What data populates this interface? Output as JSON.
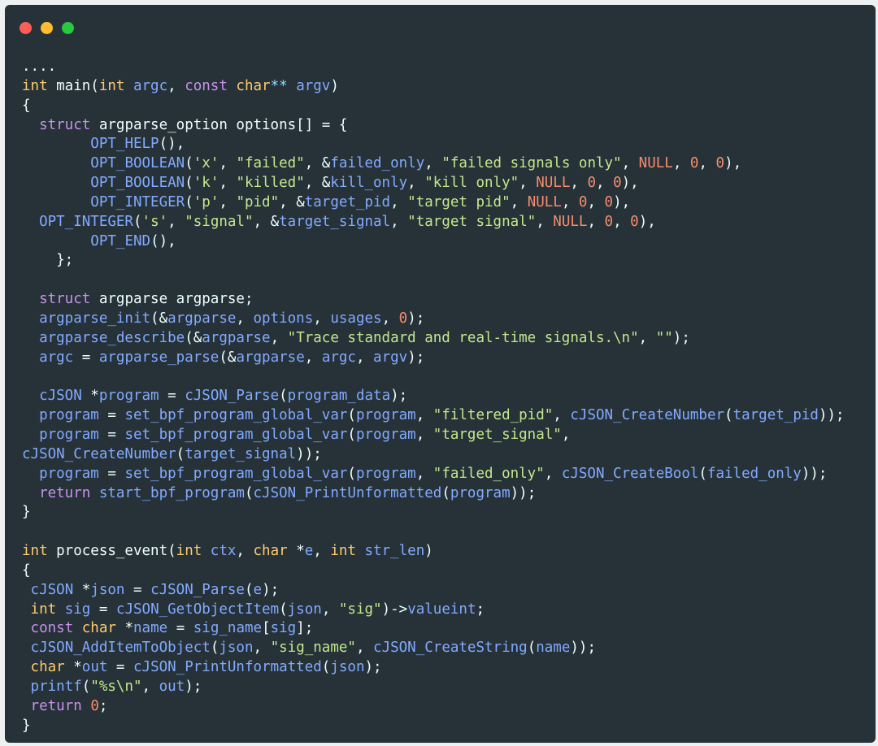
{
  "window": {
    "controls": [
      {
        "name": "close",
        "color": "#ff5f56"
      },
      {
        "name": "minimize",
        "color": "#ffbd2e"
      },
      {
        "name": "zoom",
        "color": "#27c93f"
      }
    ]
  },
  "code": {
    "language": "c",
    "lines": [
      [
        [
          "plain",
          "...."
        ]
      ],
      [
        [
          "type",
          "int"
        ],
        [
          "plain",
          " main("
        ],
        [
          "type",
          "int"
        ],
        [
          "var",
          " argc"
        ],
        [
          "plain",
          ", "
        ],
        [
          "kw",
          "const"
        ],
        [
          "type",
          " char"
        ],
        [
          "op",
          "**"
        ],
        [
          "var",
          " argv"
        ],
        [
          "plain",
          ")"
        ]
      ],
      [
        [
          "plain",
          "{"
        ]
      ],
      [
        [
          "plain",
          "  "
        ],
        [
          "kw",
          "struct"
        ],
        [
          "plain",
          " argparse_option options[] = {"
        ]
      ],
      [
        [
          "plain",
          "        "
        ],
        [
          "fn",
          "OPT_HELP"
        ],
        [
          "plain",
          "(),"
        ]
      ],
      [
        [
          "plain",
          "        "
        ],
        [
          "fn",
          "OPT_BOOLEAN"
        ],
        [
          "plain",
          "("
        ],
        [
          "str",
          "'x'"
        ],
        [
          "plain",
          ", "
        ],
        [
          "str",
          "\"failed\""
        ],
        [
          "plain",
          ", &"
        ],
        [
          "var",
          "failed_only"
        ],
        [
          "plain",
          ", "
        ],
        [
          "str",
          "\"failed signals only\""
        ],
        [
          "plain",
          ", "
        ],
        [
          "null",
          "NULL"
        ],
        [
          "plain",
          ", "
        ],
        [
          "num",
          "0"
        ],
        [
          "plain",
          ", "
        ],
        [
          "num",
          "0"
        ],
        [
          "plain",
          "),"
        ]
      ],
      [
        [
          "plain",
          "        "
        ],
        [
          "fn",
          "OPT_BOOLEAN"
        ],
        [
          "plain",
          "("
        ],
        [
          "str",
          "'k'"
        ],
        [
          "plain",
          ", "
        ],
        [
          "str",
          "\"killed\""
        ],
        [
          "plain",
          ", &"
        ],
        [
          "var",
          "kill_only"
        ],
        [
          "plain",
          ", "
        ],
        [
          "str",
          "\"kill only\""
        ],
        [
          "plain",
          ", "
        ],
        [
          "null",
          "NULL"
        ],
        [
          "plain",
          ", "
        ],
        [
          "num",
          "0"
        ],
        [
          "plain",
          ", "
        ],
        [
          "num",
          "0"
        ],
        [
          "plain",
          "),"
        ]
      ],
      [
        [
          "plain",
          "        "
        ],
        [
          "fn",
          "OPT_INTEGER"
        ],
        [
          "plain",
          "("
        ],
        [
          "str",
          "'p'"
        ],
        [
          "plain",
          ", "
        ],
        [
          "str",
          "\"pid\""
        ],
        [
          "plain",
          ", &"
        ],
        [
          "var",
          "target_pid"
        ],
        [
          "plain",
          ", "
        ],
        [
          "str",
          "\"target pid\""
        ],
        [
          "plain",
          ", "
        ],
        [
          "null",
          "NULL"
        ],
        [
          "plain",
          ", "
        ],
        [
          "num",
          "0"
        ],
        [
          "plain",
          ", "
        ],
        [
          "num",
          "0"
        ],
        [
          "plain",
          "),"
        ]
      ],
      [
        [
          "plain",
          "  "
        ],
        [
          "fn",
          "OPT_INTEGER"
        ],
        [
          "plain",
          "("
        ],
        [
          "str",
          "'s'"
        ],
        [
          "plain",
          ", "
        ],
        [
          "str",
          "\"signal\""
        ],
        [
          "plain",
          ", &"
        ],
        [
          "var",
          "target_signal"
        ],
        [
          "plain",
          ", "
        ],
        [
          "str",
          "\"target signal\""
        ],
        [
          "plain",
          ", "
        ],
        [
          "null",
          "NULL"
        ],
        [
          "plain",
          ", "
        ],
        [
          "num",
          "0"
        ],
        [
          "plain",
          ", "
        ],
        [
          "num",
          "0"
        ],
        [
          "plain",
          "),"
        ]
      ],
      [
        [
          "plain",
          "        "
        ],
        [
          "fn",
          "OPT_END"
        ],
        [
          "plain",
          "(),"
        ]
      ],
      [
        [
          "plain",
          "    };"
        ]
      ],
      [
        [
          "plain",
          ""
        ]
      ],
      [
        [
          "plain",
          "  "
        ],
        [
          "kw",
          "struct"
        ],
        [
          "plain",
          " argparse argparse;"
        ]
      ],
      [
        [
          "plain",
          "  "
        ],
        [
          "fn",
          "argparse_init"
        ],
        [
          "plain",
          "(&"
        ],
        [
          "var",
          "argparse"
        ],
        [
          "plain",
          ", "
        ],
        [
          "var",
          "options"
        ],
        [
          "plain",
          ", "
        ],
        [
          "var",
          "usages"
        ],
        [
          "plain",
          ", "
        ],
        [
          "num",
          "0"
        ],
        [
          "plain",
          ");"
        ]
      ],
      [
        [
          "plain",
          "  "
        ],
        [
          "fn",
          "argparse_describe"
        ],
        [
          "plain",
          "(&"
        ],
        [
          "var",
          "argparse"
        ],
        [
          "plain",
          ", "
        ],
        [
          "str",
          "\"Trace standard and real-time signals.\\n\""
        ],
        [
          "plain",
          ", "
        ],
        [
          "str",
          "\"\""
        ],
        [
          "plain",
          ");"
        ]
      ],
      [
        [
          "plain",
          "  "
        ],
        [
          "var",
          "argc"
        ],
        [
          "plain",
          " = "
        ],
        [
          "fn",
          "argparse_parse"
        ],
        [
          "plain",
          "(&"
        ],
        [
          "var",
          "argparse"
        ],
        [
          "plain",
          ", "
        ],
        [
          "var",
          "argc"
        ],
        [
          "plain",
          ", "
        ],
        [
          "var",
          "argv"
        ],
        [
          "plain",
          ");"
        ]
      ],
      [
        [
          "plain",
          ""
        ]
      ],
      [
        [
          "plain",
          "  "
        ],
        [
          "var",
          "cJSON"
        ],
        [
          "plain",
          " *"
        ],
        [
          "var",
          "program"
        ],
        [
          "plain",
          " = "
        ],
        [
          "fn",
          "cJSON_Parse"
        ],
        [
          "plain",
          "("
        ],
        [
          "var",
          "program_data"
        ],
        [
          "plain",
          ");"
        ]
      ],
      [
        [
          "plain",
          "  "
        ],
        [
          "var",
          "program"
        ],
        [
          "plain",
          " = "
        ],
        [
          "fn",
          "set_bpf_program_global_var"
        ],
        [
          "plain",
          "("
        ],
        [
          "var",
          "program"
        ],
        [
          "plain",
          ", "
        ],
        [
          "str",
          "\"filtered_pid\""
        ],
        [
          "plain",
          ", "
        ],
        [
          "fn",
          "cJSON_CreateNumber"
        ],
        [
          "plain",
          "("
        ],
        [
          "var",
          "target_pid"
        ],
        [
          "plain",
          "));"
        ]
      ],
      [
        [
          "plain",
          "  "
        ],
        [
          "var",
          "program"
        ],
        [
          "plain",
          " = "
        ],
        [
          "fn",
          "set_bpf_program_global_var"
        ],
        [
          "plain",
          "("
        ],
        [
          "var",
          "program"
        ],
        [
          "plain",
          ", "
        ],
        [
          "str",
          "\"target_signal\""
        ],
        [
          "plain",
          ","
        ]
      ],
      [
        [
          "fn",
          "cJSON_CreateNumber"
        ],
        [
          "plain",
          "("
        ],
        [
          "var",
          "target_signal"
        ],
        [
          "plain",
          "));"
        ]
      ],
      [
        [
          "plain",
          "  "
        ],
        [
          "var",
          "program"
        ],
        [
          "plain",
          " = "
        ],
        [
          "fn",
          "set_bpf_program_global_var"
        ],
        [
          "plain",
          "("
        ],
        [
          "var",
          "program"
        ],
        [
          "plain",
          ", "
        ],
        [
          "str",
          "\"failed_only\""
        ],
        [
          "plain",
          ", "
        ],
        [
          "fn",
          "cJSON_CreateBool"
        ],
        [
          "plain",
          "("
        ],
        [
          "var",
          "failed_only"
        ],
        [
          "plain",
          "));"
        ]
      ],
      [
        [
          "plain",
          "  "
        ],
        [
          "kw",
          "return"
        ],
        [
          "plain",
          " "
        ],
        [
          "fn",
          "start_bpf_program"
        ],
        [
          "plain",
          "("
        ],
        [
          "fn",
          "cJSON_PrintUnformatted"
        ],
        [
          "plain",
          "("
        ],
        [
          "var",
          "program"
        ],
        [
          "plain",
          "));"
        ]
      ],
      [
        [
          "plain",
          "}"
        ]
      ],
      [
        [
          "plain",
          ""
        ]
      ],
      [
        [
          "type",
          "int"
        ],
        [
          "plain",
          " process_event("
        ],
        [
          "type",
          "int"
        ],
        [
          "var",
          " ctx"
        ],
        [
          "plain",
          ", "
        ],
        [
          "type",
          "char"
        ],
        [
          "plain",
          " *"
        ],
        [
          "var",
          "e"
        ],
        [
          "plain",
          ", "
        ],
        [
          "type",
          "int"
        ],
        [
          "var",
          " str_len"
        ],
        [
          "plain",
          ")"
        ]
      ],
      [
        [
          "plain",
          "{"
        ]
      ],
      [
        [
          "plain",
          " "
        ],
        [
          "var",
          "cJSON"
        ],
        [
          "plain",
          " *"
        ],
        [
          "var",
          "json"
        ],
        [
          "plain",
          " = "
        ],
        [
          "fn",
          "cJSON_Parse"
        ],
        [
          "plain",
          "("
        ],
        [
          "var",
          "e"
        ],
        [
          "plain",
          ");"
        ]
      ],
      [
        [
          "plain",
          " "
        ],
        [
          "type",
          "int"
        ],
        [
          "var",
          " sig"
        ],
        [
          "plain",
          " = "
        ],
        [
          "fn",
          "cJSON_GetObjectItem"
        ],
        [
          "plain",
          "("
        ],
        [
          "var",
          "json"
        ],
        [
          "plain",
          ", "
        ],
        [
          "str",
          "\"sig\""
        ],
        [
          "plain",
          ")->"
        ],
        [
          "var",
          "valueint"
        ],
        [
          "plain",
          ";"
        ]
      ],
      [
        [
          "plain",
          " "
        ],
        [
          "kw",
          "const"
        ],
        [
          "type",
          " char"
        ],
        [
          "plain",
          " *"
        ],
        [
          "var",
          "name"
        ],
        [
          "plain",
          " = "
        ],
        [
          "var",
          "sig_name"
        ],
        [
          "plain",
          "["
        ],
        [
          "var",
          "sig"
        ],
        [
          "plain",
          "];"
        ]
      ],
      [
        [
          "plain",
          " "
        ],
        [
          "fn",
          "cJSON_AddItemToObject"
        ],
        [
          "plain",
          "("
        ],
        [
          "var",
          "json"
        ],
        [
          "plain",
          ", "
        ],
        [
          "str",
          "\"sig_name\""
        ],
        [
          "plain",
          ", "
        ],
        [
          "fn",
          "cJSON_CreateString"
        ],
        [
          "plain",
          "("
        ],
        [
          "var",
          "name"
        ],
        [
          "plain",
          "));"
        ]
      ],
      [
        [
          "plain",
          " "
        ],
        [
          "type",
          "char"
        ],
        [
          "plain",
          " *"
        ],
        [
          "var",
          "out"
        ],
        [
          "plain",
          " = "
        ],
        [
          "fn",
          "cJSON_PrintUnformatted"
        ],
        [
          "plain",
          "("
        ],
        [
          "var",
          "json"
        ],
        [
          "plain",
          ");"
        ]
      ],
      [
        [
          "plain",
          " "
        ],
        [
          "fn",
          "printf"
        ],
        [
          "plain",
          "("
        ],
        [
          "str",
          "\"%s\\n\""
        ],
        [
          "plain",
          ", "
        ],
        [
          "var",
          "out"
        ],
        [
          "plain",
          ");"
        ]
      ],
      [
        [
          "plain",
          " "
        ],
        [
          "kw",
          "return"
        ],
        [
          "plain",
          " "
        ],
        [
          "num",
          "0"
        ],
        [
          "plain",
          ";"
        ]
      ],
      [
        [
          "plain",
          "}"
        ]
      ]
    ]
  }
}
